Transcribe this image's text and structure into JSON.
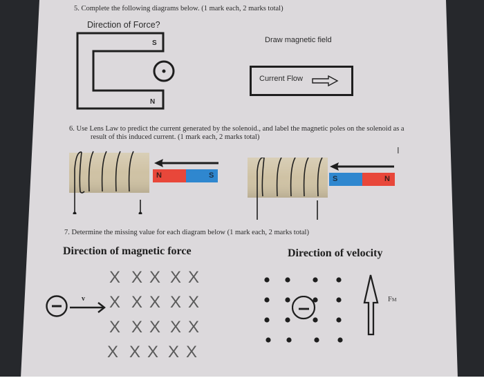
{
  "colors": {
    "desk": "#26282c",
    "paper": "#dcd9dc",
    "ink": "#1e1e1e",
    "magnet_red": "#e8473a",
    "magnet_blue": "#2f87cf",
    "coil_tube": "#cfc2a4"
  },
  "q5": {
    "prompt": "5. Complete the following diagrams below. (1 mark each, 2 marks total)",
    "left": {
      "title": "Direction of Force?",
      "magnet_top_pole": "S",
      "magnet_bottom_pole": "N",
      "wire_symbol": "current-out-of-page-icon"
    },
    "right": {
      "title": "Draw magnetic field",
      "box_label": "Current Flow",
      "arrow_symbol": "hollow-right-arrow-icon"
    }
  },
  "q6": {
    "prompt_line1": "6. Use Lens Law to predict the current generated by the solenoid., and label the magnetic poles on the solenoid as a",
    "prompt_line2": "result of this induced current. (1 mark each, 2 marks total)",
    "diagram1": {
      "left_pole": "N",
      "right_pole": "S",
      "motion": "toward-solenoid"
    },
    "diagram2": {
      "left_pole": "S",
      "right_pole": "N",
      "motion": "toward-solenoid"
    },
    "cursor": "I"
  },
  "q7": {
    "prompt": "7. Determine the missing value for each diagram below (1 mark each, 2 marks total)",
    "left": {
      "title": "Direction of magnetic force",
      "field_symbol": "X",
      "field_rows": 4,
      "field_cols": 5,
      "charge": "−",
      "velocity_label": "v"
    },
    "right": {
      "title": "Direction of velocity",
      "field_rows": 4,
      "field_cols": 4,
      "charge": "−",
      "force_label": "F",
      "force_subscript": "M"
    }
  }
}
